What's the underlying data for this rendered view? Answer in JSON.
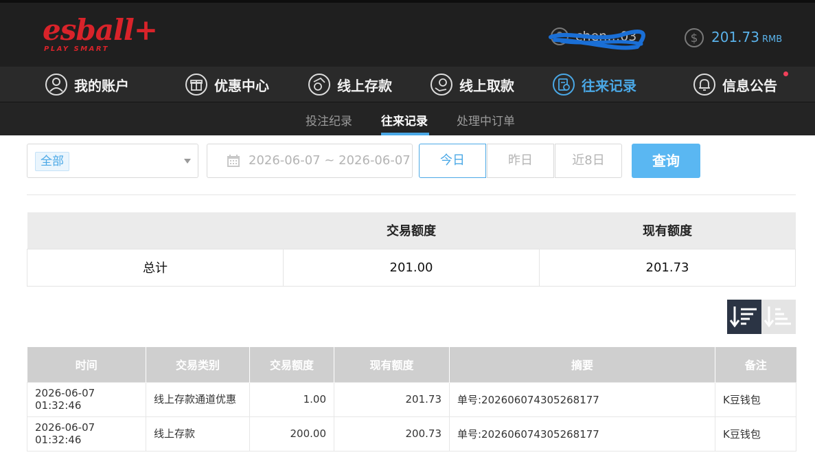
{
  "brand": {
    "logo_text": "esball+",
    "logo_sub": "PLAY SMART",
    "color": "#d9232a"
  },
  "header": {
    "username": "chen…03",
    "balance": "201.73",
    "currency": "RMB",
    "icons": [
      "user-icon",
      "coin-icon"
    ]
  },
  "nav": {
    "items": [
      {
        "label": "我的账户",
        "icon": "user-circle-icon"
      },
      {
        "label": "优惠中心",
        "icon": "gift-icon"
      },
      {
        "label": "线上存款",
        "icon": "deposit-icon"
      },
      {
        "label": "线上取款",
        "icon": "withdraw-icon"
      },
      {
        "label": "往来记录",
        "icon": "records-icon",
        "active": true
      },
      {
        "label": "信息公告",
        "icon": "bell-icon",
        "badge": true
      }
    ]
  },
  "subnav": {
    "items": [
      {
        "label": "投注纪录"
      },
      {
        "label": "往来记录",
        "active": true
      },
      {
        "label": "处理中订单"
      }
    ]
  },
  "filters": {
    "type_selected": "全部",
    "date_range": "2026-06-07 ~ 2026-06-07",
    "quick_ranges": [
      "今日",
      "昨日",
      "近8日"
    ],
    "active_range": "今日",
    "query_label": "查询"
  },
  "summary": {
    "headers": [
      "",
      "交易额度",
      "现有额度"
    ],
    "row": [
      "总计",
      "201.00",
      "201.73"
    ]
  },
  "records": {
    "headers": [
      "时间",
      "交易类别",
      "交易额度",
      "现有额度",
      "摘要",
      "备注"
    ],
    "rows": [
      [
        "2026-06-07 01:32:46",
        "线上存款通道优惠",
        "1.00",
        "201.73",
        "单号:202606074305268177",
        "K豆钱包"
      ],
      [
        "2026-06-07 01:32:46",
        "线上存款",
        "200.00",
        "200.73",
        "单号:202606074305268177",
        "K豆钱包"
      ]
    ]
  },
  "colors": {
    "accent": "#4aa8e6",
    "header_bg": "#1f1f1f",
    "query_button": "#5ab7f2",
    "badge": "#f0405a"
  }
}
